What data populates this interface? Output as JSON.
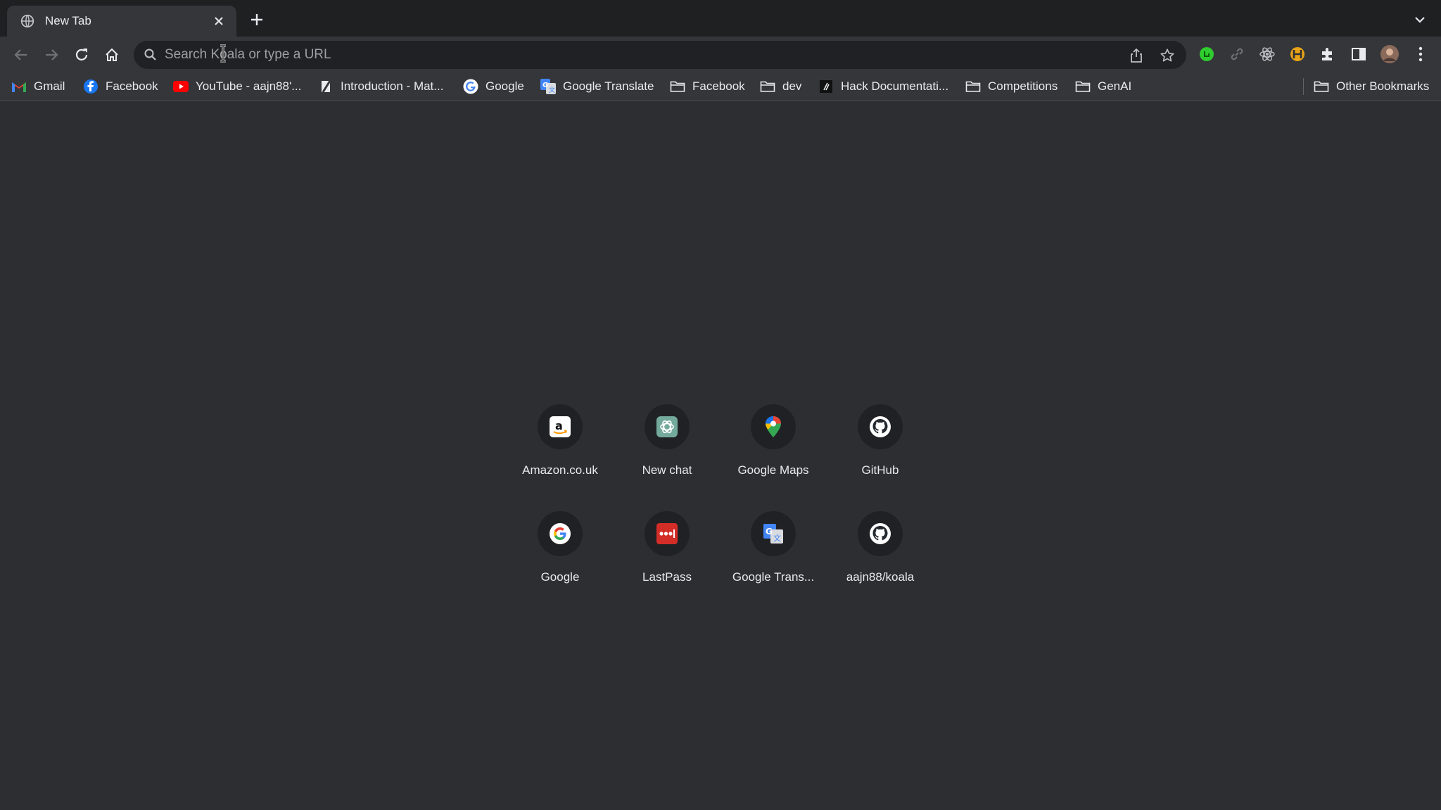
{
  "tab": {
    "title": "New Tab"
  },
  "omnibox": {
    "placeholder": "Search Koala or type a URL"
  },
  "bookmarks": {
    "items": [
      {
        "label": "Gmail",
        "icon": "gmail-icon"
      },
      {
        "label": "Facebook",
        "icon": "facebook-icon"
      },
      {
        "label": "YouTube - aajn88'...",
        "icon": "youtube-icon"
      },
      {
        "label": "Introduction - Mat...",
        "icon": "page-icon"
      },
      {
        "label": "Google",
        "icon": "google-icon"
      },
      {
        "label": "Google Translate",
        "icon": "google-translate-icon"
      },
      {
        "label": "Facebook",
        "icon": "folder-icon"
      },
      {
        "label": "dev",
        "icon": "folder-icon"
      },
      {
        "label": "Hack Documentati...",
        "icon": "hack-icon"
      },
      {
        "label": "Competitions",
        "icon": "folder-icon"
      },
      {
        "label": "GenAI",
        "icon": "folder-icon"
      }
    ],
    "other": {
      "label": "Other Bookmarks",
      "icon": "folder-icon"
    }
  },
  "shortcuts": [
    {
      "label": "Amazon.co.uk",
      "icon": "amazon-icon"
    },
    {
      "label": "New chat",
      "icon": "chatgpt-icon"
    },
    {
      "label": "Google Maps",
      "icon": "google-maps-icon"
    },
    {
      "label": "GitHub",
      "icon": "github-icon"
    },
    {
      "label": "Google",
      "icon": "google-icon"
    },
    {
      "label": "LastPass",
      "icon": "lastpass-icon"
    },
    {
      "label": "Google Trans...",
      "icon": "google-translate-icon"
    },
    {
      "label": "aajn88/koala",
      "icon": "github-icon"
    }
  ],
  "colors": {
    "background": "#2d2e31",
    "toolbar": "#35363a",
    "tabstrip": "#1f2022",
    "omnibox": "#202124",
    "text": "#e8eaed"
  }
}
